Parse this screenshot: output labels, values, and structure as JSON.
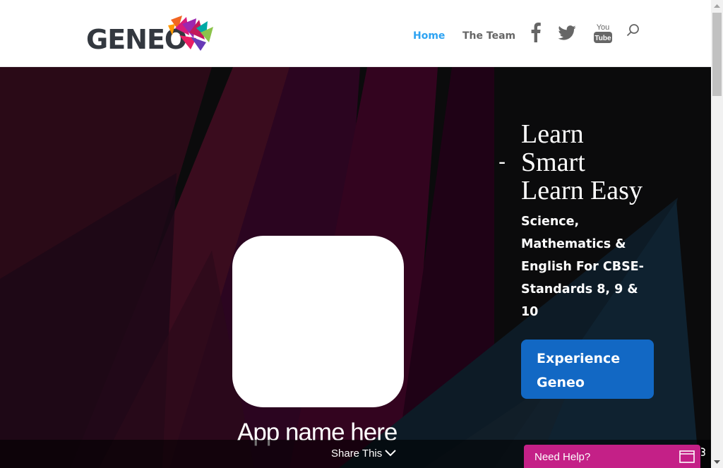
{
  "header": {
    "logo_text": "GENEO",
    "nav": [
      {
        "label": "Home",
        "active": true
      },
      {
        "label": "The Team",
        "active": false
      }
    ],
    "social_icons": [
      "facebook-icon",
      "twitter-icon",
      "youtube-icon"
    ],
    "youtube_top": "You",
    "youtube_bottom": "Tube",
    "search_icon": "search-icon",
    "colors": {
      "active_nav": "#2ea3f2",
      "nav": "#666666"
    }
  },
  "hero": {
    "dash": "-",
    "headline": [
      "Learn",
      "Smart",
      "Learn Easy"
    ],
    "subtext": "Science, Mathematics & English For CBSE- Standards 8, 9 & 10",
    "cta_label": "Experience Geneo",
    "app_name": "App name here",
    "colors": {
      "cta": "#1268c4"
    }
  },
  "share_bar": {
    "label": "Share This",
    "icon": "chevron-down-icon"
  },
  "help_widget": {
    "label": "Need Help?",
    "icon": "chat-window-icon",
    "color": "#c42087"
  }
}
